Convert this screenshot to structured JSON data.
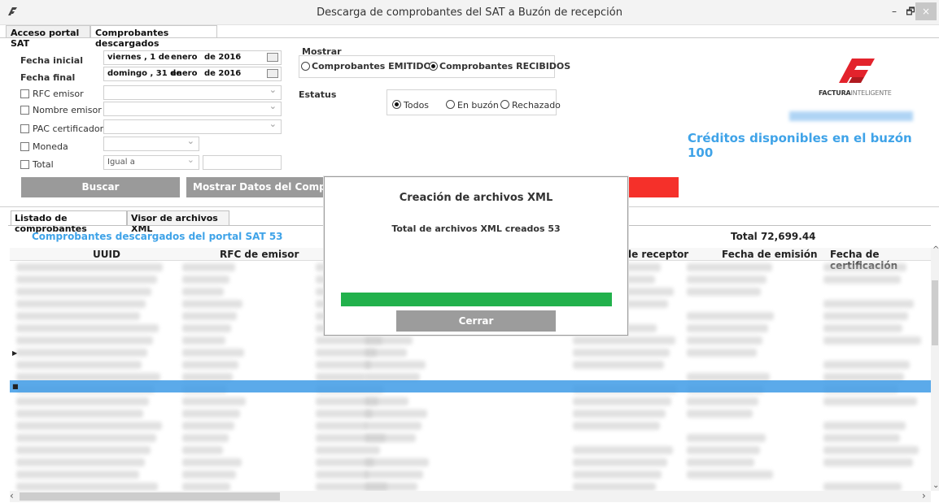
{
  "window": {
    "title": "Descarga de comprobantes del SAT a Buzón de recepción",
    "minimize": "–",
    "maximize": "🗗",
    "close": "×"
  },
  "tabs": [
    "Acceso portal SAT",
    "Comprobantes descargados"
  ],
  "form": {
    "fecha_inicial_label": "Fecha inicial",
    "fecha_inicial": {
      "day": "viernes ,  1 de",
      "month": "enero",
      "year": "de 2016"
    },
    "fecha_final_label": "Fecha final",
    "fecha_final": {
      "day": "domingo , 31 de",
      "month": "enero",
      "year": "de 2016"
    },
    "rfc_emisor": "RFC emisor",
    "nombre_emisor": "Nombre emisor",
    "pac_certificador": "PAC certificador",
    "moneda": "Moneda",
    "total": "Total",
    "total_operator": "Igual a"
  },
  "mostrar": {
    "label": "Mostrar",
    "emitidos": "Comprobantes EMITIDOS",
    "recibidos": "Comprobantes RECIBIDOS",
    "selected": "recibidos"
  },
  "estatus": {
    "label": "Estatus",
    "todos": "Todos",
    "en_buzon": "En buzón",
    "rechazado": "Rechazado",
    "selected": "todos"
  },
  "brand": {
    "name_bold": "FACTURA",
    "name_light": "INTELIGENTE",
    "accent": "#e3232c"
  },
  "creditos": "Créditos disponibles en el buzón 100",
  "buttons": {
    "buscar": "Buscar",
    "mostrar_datos": "Mostrar Datos del Comproba"
  },
  "lower_tabs": [
    "Listado de comprobantes",
    "Visor de archivos XML"
  ],
  "grid": {
    "summary": "Comprobantes descargados del portal SAT 53",
    "total": "Total 72,699.44",
    "columns": [
      "UUID",
      "RFC de emisor",
      "le receptor",
      "Fecha de emisión",
      "Fecha de certificación"
    ]
  },
  "modal": {
    "title": "Creación de archivos XML",
    "message": "Total de archivos XML creados 53",
    "progress": 1.0,
    "close_label": "Cerrar"
  },
  "colors": {
    "link_blue": "#3fa3e8",
    "progress_green": "#22b14c",
    "selection_blue": "#3e9be6"
  }
}
